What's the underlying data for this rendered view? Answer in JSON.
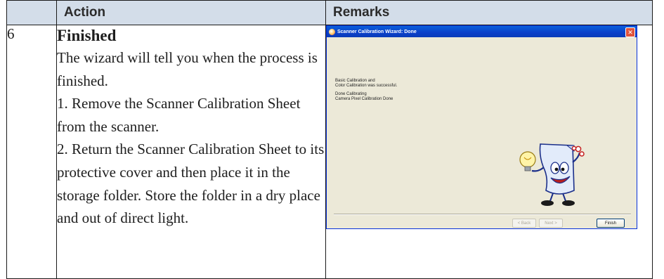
{
  "table": {
    "headers": {
      "number": "",
      "action": "Action",
      "remarks": "Remarks"
    },
    "row": {
      "number": "6",
      "step_title": "Finished",
      "lines": [
        "The wizard will tell you when the process is finished.",
        "1. Remove the Scanner Calibration Sheet from the scanner.",
        "2. Return the Scanner Calibration Sheet to its protective cover and then place it in the storage folder. Store the folder in a dry place and out of direct light."
      ]
    }
  },
  "wizard": {
    "title": "Scanner Calibration Wizard: Done",
    "close_glyph": "✕",
    "messages": [
      "Basic Calibration and",
      "Color Calibration was successful.",
      "Done Calibrating",
      "Camera Pixel Calibration Done"
    ],
    "buttons": {
      "back": "< Back",
      "next": "Next >",
      "finish": "Finish"
    }
  },
  "colors": {
    "header_bg": "#d3dde9",
    "titlebar": "#0b3fc9",
    "dialog_bg": "#ece9d8"
  }
}
